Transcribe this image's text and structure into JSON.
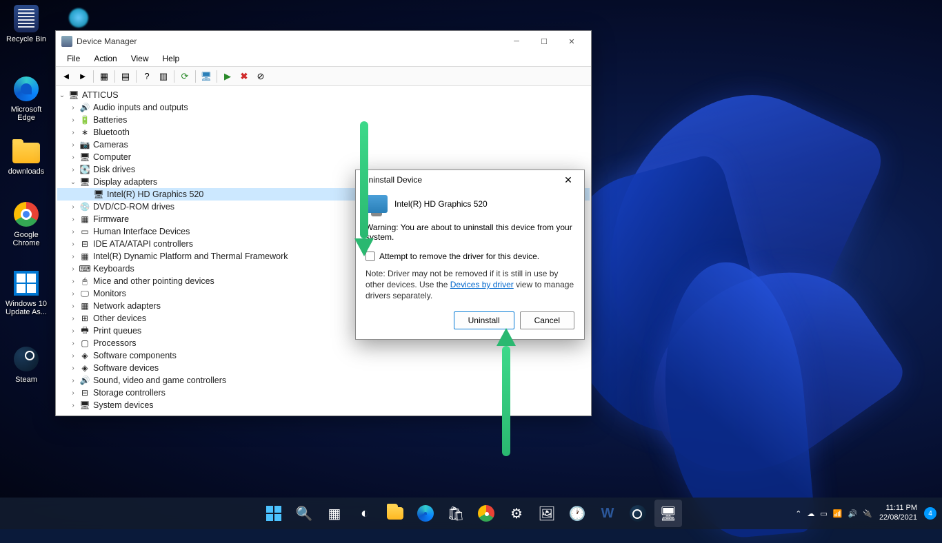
{
  "desktop": {
    "icons": [
      {
        "label": "Recycle Bin"
      },
      {
        "label": "Microsoft Edge"
      },
      {
        "label": "downloads"
      },
      {
        "label": "Google Chrome"
      },
      {
        "label": "Windows 10 Update As..."
      },
      {
        "label": "Steam"
      }
    ]
  },
  "devmgr": {
    "title": "Device Manager",
    "menu": [
      "File",
      "Action",
      "View",
      "Help"
    ],
    "root": "ATTICUS",
    "nodes": [
      {
        "label": "Audio inputs and outputs",
        "icon": "🔊"
      },
      {
        "label": "Batteries",
        "icon": "🔋"
      },
      {
        "label": "Bluetooth",
        "icon": "∗"
      },
      {
        "label": "Cameras",
        "icon": "📷"
      },
      {
        "label": "Computer",
        "icon": "🖥"
      },
      {
        "label": "Disk drives",
        "icon": "💽"
      },
      {
        "label": "Display adapters",
        "icon": "🖥",
        "expanded": true,
        "children": [
          {
            "label": "Intel(R) HD Graphics 520",
            "icon": "🖥",
            "selected": true
          }
        ]
      },
      {
        "label": "DVD/CD-ROM drives",
        "icon": "💿"
      },
      {
        "label": "Firmware",
        "icon": "▦"
      },
      {
        "label": "Human Interface Devices",
        "icon": "▭"
      },
      {
        "label": "IDE ATA/ATAPI controllers",
        "icon": "⊟"
      },
      {
        "label": "Intel(R) Dynamic Platform and Thermal Framework",
        "icon": "▦"
      },
      {
        "label": "Keyboards",
        "icon": "⌨"
      },
      {
        "label": "Mice and other pointing devices",
        "icon": "🖱"
      },
      {
        "label": "Monitors",
        "icon": "🖵"
      },
      {
        "label": "Network adapters",
        "icon": "▦"
      },
      {
        "label": "Other devices",
        "icon": "⊞"
      },
      {
        "label": "Print queues",
        "icon": "🖶"
      },
      {
        "label": "Processors",
        "icon": "▢"
      },
      {
        "label": "Software components",
        "icon": "◈"
      },
      {
        "label": "Software devices",
        "icon": "◈"
      },
      {
        "label": "Sound, video and game controllers",
        "icon": "🔊"
      },
      {
        "label": "Storage controllers",
        "icon": "⊟"
      },
      {
        "label": "System devices",
        "icon": "🖥"
      }
    ]
  },
  "dialog": {
    "title": "Uninstall Device",
    "device": "Intel(R) HD Graphics 520",
    "warning": "Warning: You are about to uninstall this device from your system.",
    "checkbox": "Attempt to remove the driver for this device.",
    "note_pre": "Note: Driver may not be removed if it is still in use by other devices. Use the ",
    "note_link": "Devices by driver",
    "note_post": " view to manage drivers separately.",
    "uninstall": "Uninstall",
    "cancel": "Cancel"
  },
  "taskbar": {
    "time": "11:11 PM",
    "date": "22/08/2021",
    "badge": "4"
  }
}
